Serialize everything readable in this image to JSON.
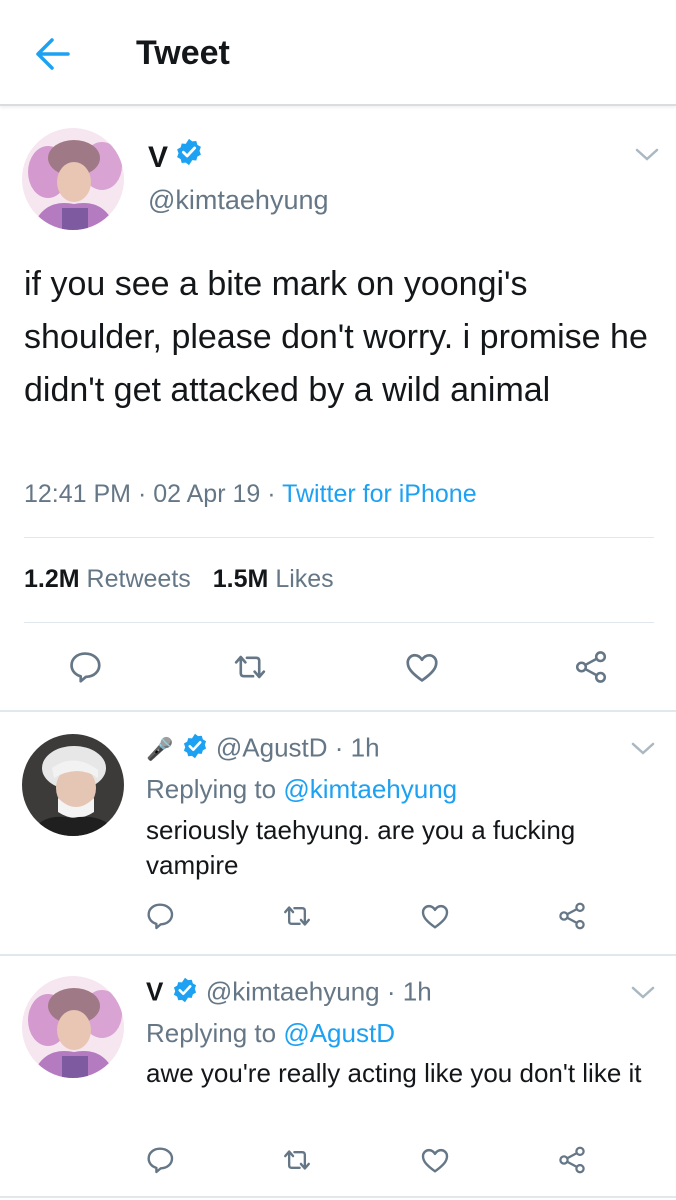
{
  "header": {
    "title": "Tweet"
  },
  "tweet": {
    "name": "V",
    "handle": "@kimtaehyung",
    "text": "if you see a bite mark on yoongi's shoulder, please don't worry. i promise he didn't get attacked by a wild animal",
    "time": "12:41 PM",
    "date": "02 Apr 19",
    "source": "Twitter for iPhone",
    "retweets_count": "1.2M",
    "retweets_label": "Retweets",
    "likes_count": "1.5M",
    "likes_label": "Likes"
  },
  "replies": [
    {
      "name_emoji": "🎤",
      "handle": "@AgustD",
      "age": "1h",
      "replying_label": "Replying to",
      "replying_to": "@kimtaehyung",
      "text": "seriously taehyung. are you a fucking vampire"
    },
    {
      "name": "V",
      "handle": "@kimtaehyung",
      "age": "1h",
      "replying_label": "Replying to",
      "replying_to": "@AgustD",
      "text": "awe you're really acting like you don't like it"
    }
  ],
  "separator": "·",
  "colors": {
    "accent": "#1da1f2",
    "secondary": "#657786",
    "text": "#14171a"
  },
  "icons": [
    "back-arrow-icon",
    "verified-badge-icon",
    "chevron-down-icon",
    "reply-icon",
    "retweet-icon",
    "like-icon",
    "share-icon",
    "microphone-emoji"
  ]
}
